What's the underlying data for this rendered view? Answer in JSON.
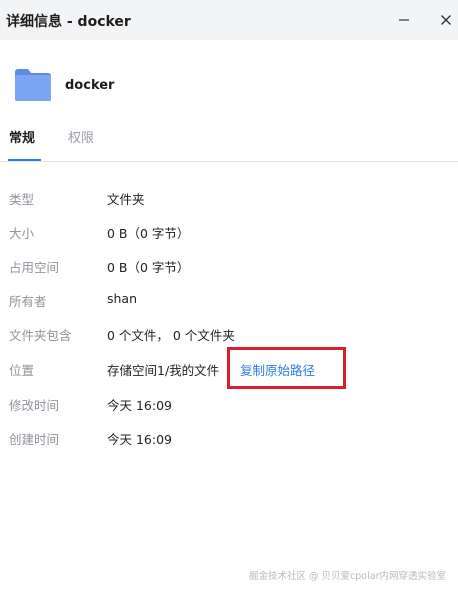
{
  "window": {
    "title": "详细信息 - docker",
    "minimize_icon": "minimize-icon",
    "close_icon": "close-icon"
  },
  "header": {
    "folder_icon": "folder-icon",
    "folder_color": "#6e9ef0",
    "name": "docker"
  },
  "tabs": [
    {
      "label": "常规",
      "active": true
    },
    {
      "label": "权限",
      "active": false
    }
  ],
  "details": {
    "type": {
      "label": "类型",
      "value": "文件夹"
    },
    "size": {
      "label": "大小",
      "value": "0 B（0 字节）"
    },
    "used_space": {
      "label": "占用空间",
      "value": "0 B（0 字节）"
    },
    "owner": {
      "label": "所有者",
      "value": "shan"
    },
    "contents": {
      "label": "文件夹包含",
      "value": "0 个文件， 0 个文件夹"
    },
    "location": {
      "label": "位置",
      "value": "存储空间1/我的文件",
      "copy_link": "复制原始路径"
    },
    "modified": {
      "label": "修改时间",
      "value": "今天 16:09"
    },
    "created": {
      "label": "创建时间",
      "value": "今天 16:09"
    }
  },
  "watermark": "掘金技术社区 @ 贝贝爱cpolar内网穿透实验室",
  "colors": {
    "accent": "#2e7be6",
    "highlight": "#d6202a",
    "titlebar_bg": "#f3f4f6"
  }
}
